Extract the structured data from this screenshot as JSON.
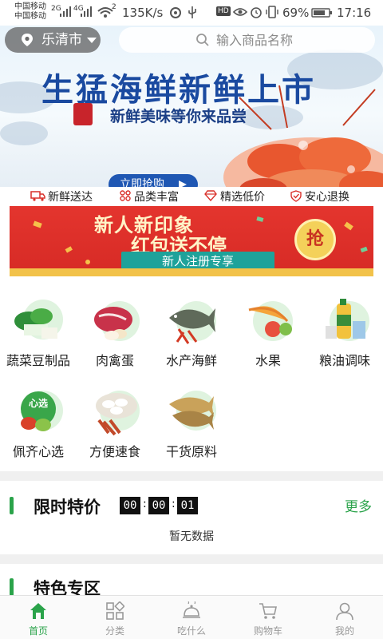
{
  "status_bar": {
    "carrier_1": "中国移动",
    "carrier_2": "中国移动",
    "sig1_type": "2G",
    "sig2_type": "4G",
    "wifi_badge": "2",
    "net_speed": "135K/s",
    "battery": "69%",
    "time": "17:16",
    "hd_badge": "HD"
  },
  "header": {
    "city": "乐清市",
    "search_placeholder": "输入商品名称"
  },
  "banner": {
    "title": "生猛海鲜新鲜上市",
    "subtitle": "新鲜美味等你来品尝",
    "button_label": "立即抢购",
    "dot_count": 3,
    "active_dot": 3
  },
  "features": [
    {
      "label": "新鲜送达",
      "icon": "delivery-truck-icon"
    },
    {
      "label": "品类丰富",
      "icon": "grid-icon"
    },
    {
      "label": "精选低价",
      "icon": "diamond-icon"
    },
    {
      "label": "安心退换",
      "icon": "shield-check-icon"
    }
  ],
  "promo": {
    "title_line1": "新人新印象",
    "title_line2": "红包送不停",
    "button_label": "新人注册专享",
    "coin_label": "抢"
  },
  "categories": [
    {
      "label": "蔬菜豆制品"
    },
    {
      "label": "肉禽蛋"
    },
    {
      "label": "水产海鲜"
    },
    {
      "label": "水果"
    },
    {
      "label": "粮油调味"
    },
    {
      "label": "佩齐心选",
      "badge": "心选"
    },
    {
      "label": "方便速食"
    },
    {
      "label": "干货原料"
    }
  ],
  "flash_sale": {
    "title": "限时特价",
    "hours": "00",
    "minutes": "00",
    "seconds": "01",
    "more_label": "更多",
    "empty_text": "暂无数据"
  },
  "special": {
    "title": "特色专区"
  },
  "bottom_nav": [
    {
      "label": "首页",
      "icon": "home-icon",
      "active": true
    },
    {
      "label": "分类",
      "icon": "category-icon",
      "active": false
    },
    {
      "label": "吃什么",
      "icon": "dish-cloche-icon",
      "active": false
    },
    {
      "label": "购物车",
      "icon": "cart-icon",
      "active": false
    },
    {
      "label": "我的",
      "icon": "user-icon",
      "active": false
    }
  ],
  "colors": {
    "accent_green": "#2aa34a",
    "banner_blue": "#1a4aa0",
    "promo_red": "#d62a25",
    "promo_teal": "#1ea29a"
  }
}
